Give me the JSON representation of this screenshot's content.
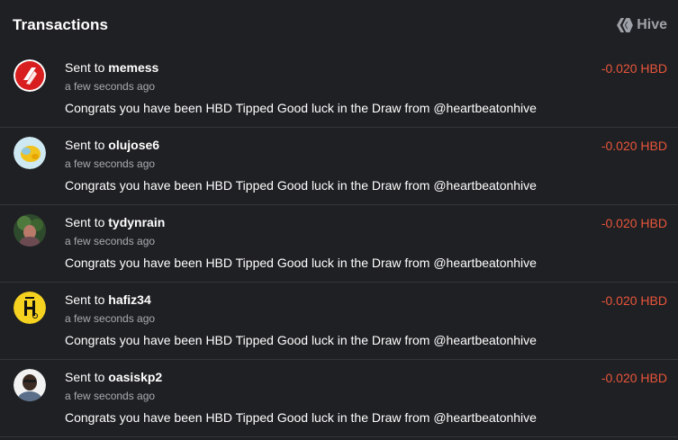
{
  "header": {
    "title": "Transactions",
    "brand_label": "Hive"
  },
  "transactions": [
    {
      "prefix": "Sent to",
      "user": "memess",
      "time": "a few seconds ago",
      "memo": "Congrats you have been HBD Tipped Good luck in the Draw from @heartbeatonhive",
      "amount": "-0.020 HBD",
      "avatar_icon": "red-logo-avatar"
    },
    {
      "prefix": "Sent to",
      "user": "olujose6",
      "time": "a few seconds ago",
      "memo": "Congrats you have been HBD Tipped Good luck in the Draw from @heartbeatonhive",
      "amount": "-0.020 HBD",
      "avatar_icon": "yellow-blob-avatar"
    },
    {
      "prefix": "Sent to",
      "user": "tydynrain",
      "time": "a few seconds ago",
      "memo": "Congrats you have been HBD Tipped Good luck in the Draw from @heartbeatonhive",
      "amount": "-0.020 HBD",
      "avatar_icon": "photo-avatar"
    },
    {
      "prefix": "Sent to",
      "user": "hafiz34",
      "time": "a few seconds ago",
      "memo": "Congrats you have been HBD Tipped Good luck in the Draw from @heartbeatonhive",
      "amount": "-0.020 HBD",
      "avatar_icon": "yellow-h-avatar"
    },
    {
      "prefix": "Sent to",
      "user": "oasiskp2",
      "time": "a few seconds ago",
      "memo": "Congrats you have been HBD Tipped Good luck in the Draw from @heartbeatonhive",
      "amount": "-0.020 HBD",
      "avatar_icon": "person-avatar"
    }
  ],
  "colors": {
    "background": "#1f2023",
    "negative_amount": "#e8553b",
    "muted": "#a7abb0",
    "divider": "#34363a"
  }
}
